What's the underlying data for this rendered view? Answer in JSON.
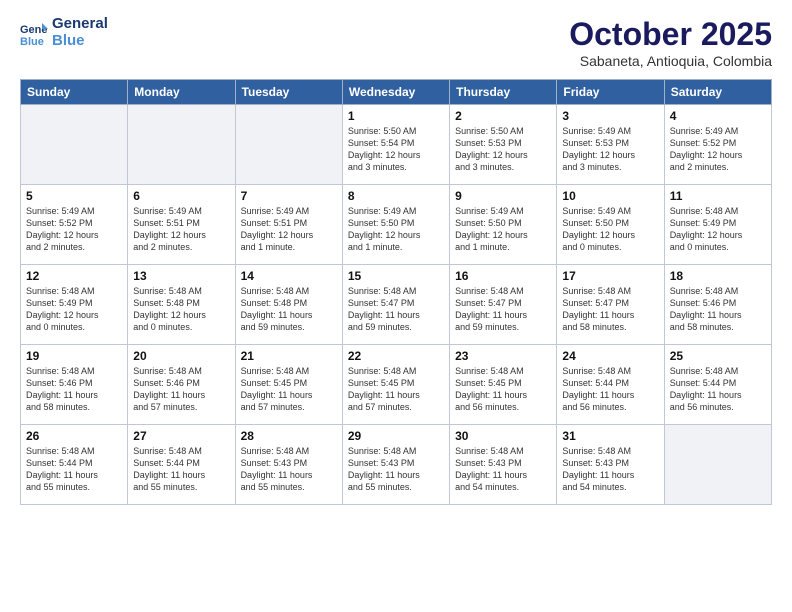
{
  "header": {
    "logo_line1": "General",
    "logo_line2": "Blue",
    "month": "October 2025",
    "location": "Sabaneta, Antioquia, Colombia"
  },
  "weekdays": [
    "Sunday",
    "Monday",
    "Tuesday",
    "Wednesday",
    "Thursday",
    "Friday",
    "Saturday"
  ],
  "weeks": [
    [
      {
        "day": "",
        "info": ""
      },
      {
        "day": "",
        "info": ""
      },
      {
        "day": "",
        "info": ""
      },
      {
        "day": "1",
        "info": "Sunrise: 5:50 AM\nSunset: 5:54 PM\nDaylight: 12 hours\nand 3 minutes."
      },
      {
        "day": "2",
        "info": "Sunrise: 5:50 AM\nSunset: 5:53 PM\nDaylight: 12 hours\nand 3 minutes."
      },
      {
        "day": "3",
        "info": "Sunrise: 5:49 AM\nSunset: 5:53 PM\nDaylight: 12 hours\nand 3 minutes."
      },
      {
        "day": "4",
        "info": "Sunrise: 5:49 AM\nSunset: 5:52 PM\nDaylight: 12 hours\nand 2 minutes."
      }
    ],
    [
      {
        "day": "5",
        "info": "Sunrise: 5:49 AM\nSunset: 5:52 PM\nDaylight: 12 hours\nand 2 minutes."
      },
      {
        "day": "6",
        "info": "Sunrise: 5:49 AM\nSunset: 5:51 PM\nDaylight: 12 hours\nand 2 minutes."
      },
      {
        "day": "7",
        "info": "Sunrise: 5:49 AM\nSunset: 5:51 PM\nDaylight: 12 hours\nand 1 minute."
      },
      {
        "day": "8",
        "info": "Sunrise: 5:49 AM\nSunset: 5:50 PM\nDaylight: 12 hours\nand 1 minute."
      },
      {
        "day": "9",
        "info": "Sunrise: 5:49 AM\nSunset: 5:50 PM\nDaylight: 12 hours\nand 1 minute."
      },
      {
        "day": "10",
        "info": "Sunrise: 5:49 AM\nSunset: 5:50 PM\nDaylight: 12 hours\nand 0 minutes."
      },
      {
        "day": "11",
        "info": "Sunrise: 5:48 AM\nSunset: 5:49 PM\nDaylight: 12 hours\nand 0 minutes."
      }
    ],
    [
      {
        "day": "12",
        "info": "Sunrise: 5:48 AM\nSunset: 5:49 PM\nDaylight: 12 hours\nand 0 minutes."
      },
      {
        "day": "13",
        "info": "Sunrise: 5:48 AM\nSunset: 5:48 PM\nDaylight: 12 hours\nand 0 minutes."
      },
      {
        "day": "14",
        "info": "Sunrise: 5:48 AM\nSunset: 5:48 PM\nDaylight: 11 hours\nand 59 minutes."
      },
      {
        "day": "15",
        "info": "Sunrise: 5:48 AM\nSunset: 5:47 PM\nDaylight: 11 hours\nand 59 minutes."
      },
      {
        "day": "16",
        "info": "Sunrise: 5:48 AM\nSunset: 5:47 PM\nDaylight: 11 hours\nand 59 minutes."
      },
      {
        "day": "17",
        "info": "Sunrise: 5:48 AM\nSunset: 5:47 PM\nDaylight: 11 hours\nand 58 minutes."
      },
      {
        "day": "18",
        "info": "Sunrise: 5:48 AM\nSunset: 5:46 PM\nDaylight: 11 hours\nand 58 minutes."
      }
    ],
    [
      {
        "day": "19",
        "info": "Sunrise: 5:48 AM\nSunset: 5:46 PM\nDaylight: 11 hours\nand 58 minutes."
      },
      {
        "day": "20",
        "info": "Sunrise: 5:48 AM\nSunset: 5:46 PM\nDaylight: 11 hours\nand 57 minutes."
      },
      {
        "day": "21",
        "info": "Sunrise: 5:48 AM\nSunset: 5:45 PM\nDaylight: 11 hours\nand 57 minutes."
      },
      {
        "day": "22",
        "info": "Sunrise: 5:48 AM\nSunset: 5:45 PM\nDaylight: 11 hours\nand 57 minutes."
      },
      {
        "day": "23",
        "info": "Sunrise: 5:48 AM\nSunset: 5:45 PM\nDaylight: 11 hours\nand 56 minutes."
      },
      {
        "day": "24",
        "info": "Sunrise: 5:48 AM\nSunset: 5:44 PM\nDaylight: 11 hours\nand 56 minutes."
      },
      {
        "day": "25",
        "info": "Sunrise: 5:48 AM\nSunset: 5:44 PM\nDaylight: 11 hours\nand 56 minutes."
      }
    ],
    [
      {
        "day": "26",
        "info": "Sunrise: 5:48 AM\nSunset: 5:44 PM\nDaylight: 11 hours\nand 55 minutes."
      },
      {
        "day": "27",
        "info": "Sunrise: 5:48 AM\nSunset: 5:44 PM\nDaylight: 11 hours\nand 55 minutes."
      },
      {
        "day": "28",
        "info": "Sunrise: 5:48 AM\nSunset: 5:43 PM\nDaylight: 11 hours\nand 55 minutes."
      },
      {
        "day": "29",
        "info": "Sunrise: 5:48 AM\nSunset: 5:43 PM\nDaylight: 11 hours\nand 55 minutes."
      },
      {
        "day": "30",
        "info": "Sunrise: 5:48 AM\nSunset: 5:43 PM\nDaylight: 11 hours\nand 54 minutes."
      },
      {
        "day": "31",
        "info": "Sunrise: 5:48 AM\nSunset: 5:43 PM\nDaylight: 11 hours\nand 54 minutes."
      },
      {
        "day": "",
        "info": ""
      }
    ]
  ]
}
